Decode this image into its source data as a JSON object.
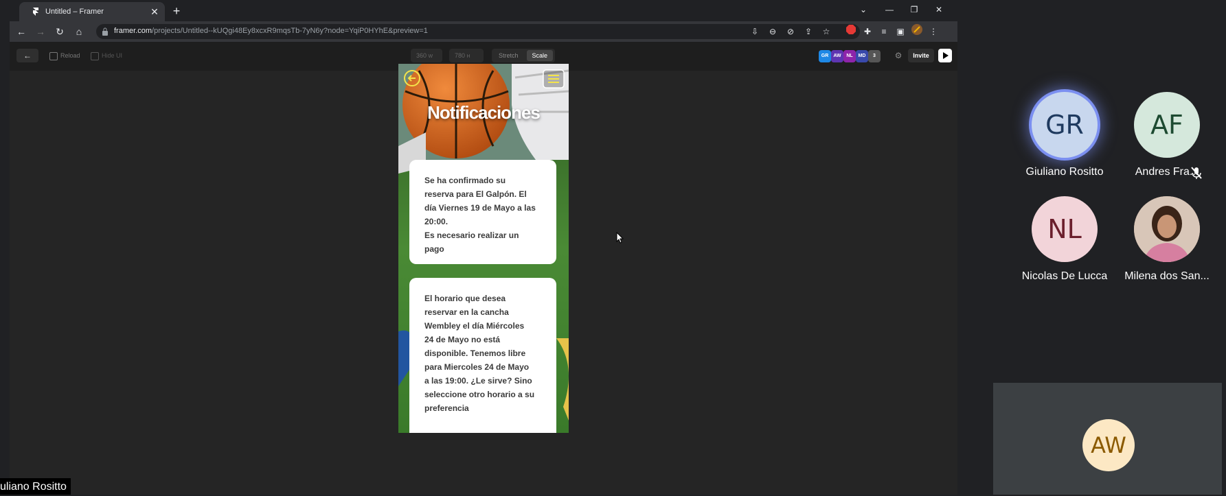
{
  "browser": {
    "tab_title": "Untitled – Framer",
    "tab_close_icon": "close-icon",
    "new_tab_icon": "plus-icon",
    "url_domain": "framer.com",
    "url_path": "/projects/Untitled--kUQgi48Ey8xcxR9mqsTb-7yN6y?node=YqiP0HYhE&preview=1"
  },
  "framer": {
    "reload_label": "Reload",
    "hide_ui_label": "Hide UI",
    "width_value": "360",
    "width_unit": "W",
    "height_value": "780",
    "height_unit": "H",
    "stretch_label": "Stretch",
    "scale_label": "Scale",
    "collaborators": [
      {
        "initials": "GR",
        "color": "#1e88e5"
      },
      {
        "initials": "AW",
        "color": "#5e35b1"
      },
      {
        "initials": "NL",
        "color": "#8e24aa"
      },
      {
        "initials": "MD",
        "color": "#3949ab"
      },
      {
        "initials": "3",
        "color": "#555555"
      }
    ],
    "invite_label": "Invite"
  },
  "phone": {
    "heading": "Notificaciones",
    "cards": [
      {
        "text": "Se ha confirmado su\nreserva para El Galpón. El\ndía Viernes 19 de Mayo a las\n20:00.\nEs necesario realizar un\npago"
      },
      {
        "text": "El horario que desea\nreservar en la cancha\nWembley  el día Miércoles\n24 de Mayo no está\ndisponible. Tenemos libre\npara Miercoles 24 de Mayo\na las 19:00. ¿Le sirve? Sino\nseleccione otro horario a su\npreferencia"
      }
    ]
  },
  "meet": {
    "participants": [
      {
        "initials": "GR",
        "name": "Giuliano Rositto",
        "bg": "#c8d7ee",
        "fg": "#1f3a5f"
      },
      {
        "initials": "AF",
        "name": "Andres Fra...",
        "bg": "#d5e8dc",
        "fg": "#1d4a31"
      },
      {
        "initials": "NL",
        "name": "Nicolas De Lucca",
        "bg": "#f2d4d9",
        "fg": "#6b1f2c"
      },
      {
        "initials": "",
        "name": "Milena dos San...",
        "bg": "#c9a48a",
        "fg": "#ffffff"
      }
    ],
    "big_tile_initials": "AW",
    "self_name_label": "uliano Rositto"
  }
}
